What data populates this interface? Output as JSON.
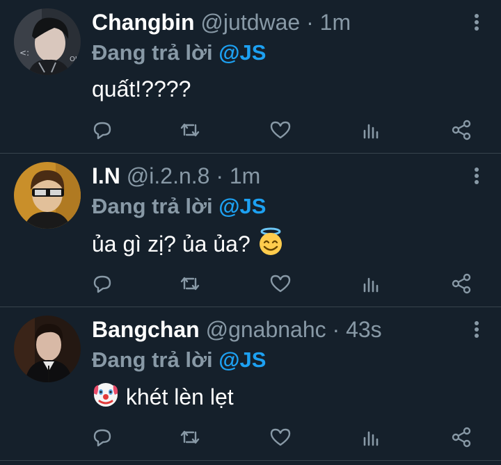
{
  "tweets": [
    {
      "name": "Changbin",
      "handle": "@jutdwae",
      "time": "1m",
      "sep": " · ",
      "reply_prefix": "Đang trả lời ",
      "reply_to": "@JS",
      "text": "quất!????",
      "avatar": "changbin-avatar"
    },
    {
      "name": "I.N",
      "handle": "@i.2.n.8",
      "time": "1m",
      "sep": " · ",
      "reply_prefix": "Đang trả lời ",
      "reply_to": "@JS",
      "text": "ủa gì zị? ủa ủa?",
      "emoji_after": "smiling-face-with-halo",
      "avatar": "in-avatar"
    },
    {
      "name": "Bangchan",
      "handle": "@gnabnahc",
      "time": "43s",
      "sep": " · ",
      "reply_prefix": "Đang trả lời ",
      "reply_to": "@JS",
      "text": "khét lèn lẹt",
      "emoji_before": "clown-face",
      "avatar": "bangchan-avatar"
    }
  ],
  "colors": {
    "background": "#15202b",
    "secondary_text": "#8899a6",
    "accent": "#1da1f2",
    "divider": "#38444d"
  },
  "actions": [
    "reply-icon",
    "retweet-icon",
    "like-icon",
    "analytics-icon",
    "share-icon"
  ]
}
